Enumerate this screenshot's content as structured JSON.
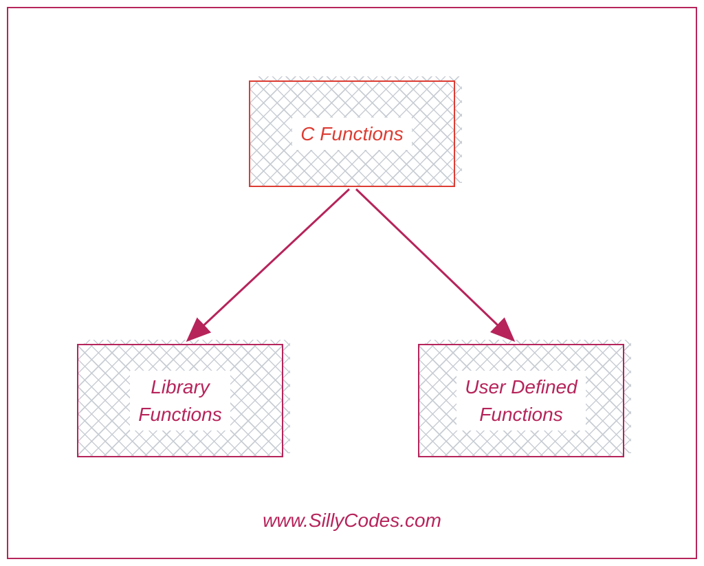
{
  "diagram": {
    "root": {
      "label": "C Functions"
    },
    "children": [
      {
        "label": "Library\nFunctions"
      },
      {
        "label": "User Defined\nFunctions"
      }
    ],
    "footer": "www.SillyCodes.com"
  },
  "colors": {
    "primary": "#b6245a",
    "accent": "#dd3c32",
    "hatch": "#c8cdd4"
  }
}
